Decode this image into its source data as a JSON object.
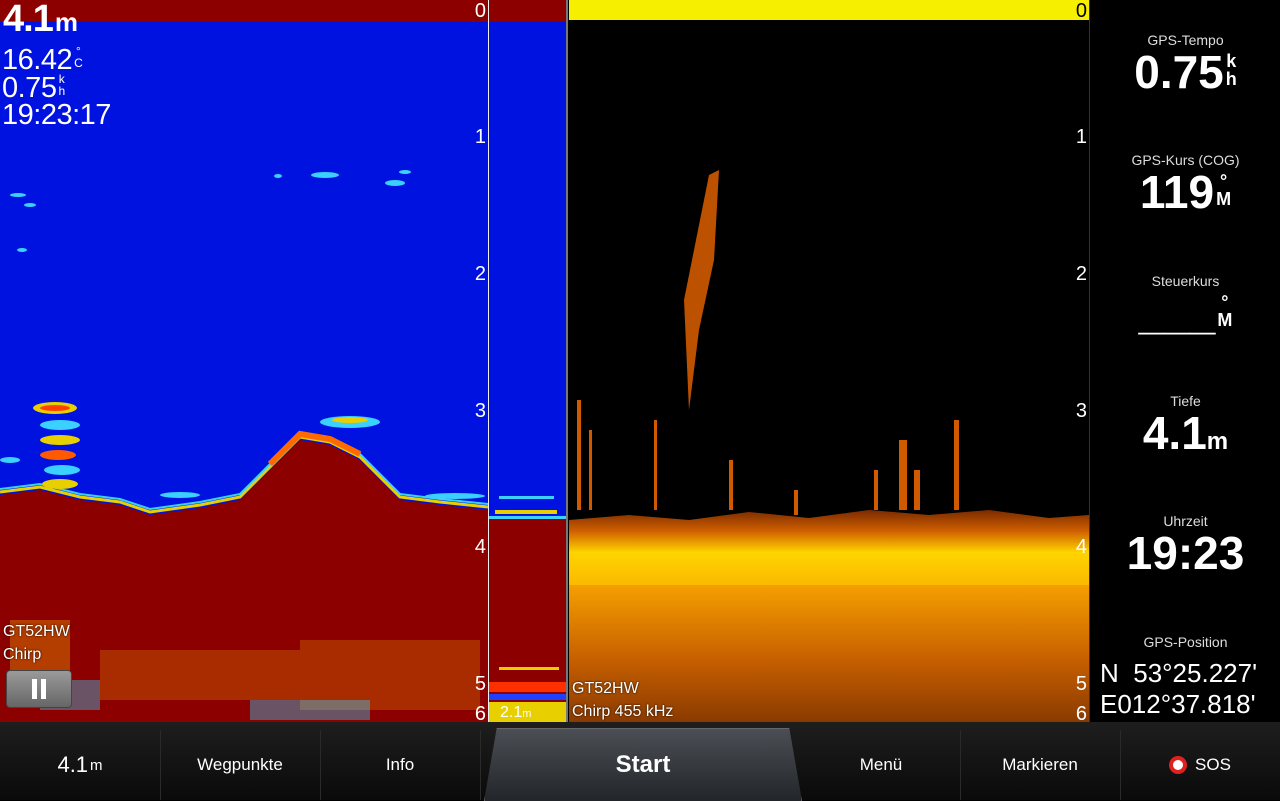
{
  "left_overlay": {
    "depth_value": "4.1",
    "depth_unit": "m",
    "temp_value": "16.42",
    "temp_unit_top": "°",
    "temp_unit_bottom": "C",
    "speed_value": "0.75",
    "speed_unit_top": "k",
    "speed_unit_bottom": "h",
    "time": "19:23:17",
    "transducer": "GT52HW",
    "frequency": "Chirp",
    "flasher_depth": "2.1",
    "flasher_unit": "m"
  },
  "right_overlay": {
    "transducer": "GT52HW",
    "frequency": "Chirp 455 kHz"
  },
  "depth_scale": [
    "0",
    "1",
    "2",
    "3",
    "4",
    "5",
    "6"
  ],
  "sidebar": {
    "gps_speed": {
      "label": "GPS-Tempo",
      "value": "0.75",
      "unit_top": "k",
      "unit_bottom": "h"
    },
    "gps_course": {
      "label": "GPS-Kurs (COG)",
      "value": "119",
      "unit_top": "°",
      "unit_bottom": "M"
    },
    "heading": {
      "label": "Steuerkurs",
      "value": "___",
      "unit_top": "°",
      "unit_bottom": "M"
    },
    "depth": {
      "label": "Tiefe",
      "value": "4.1",
      "unit": "m"
    },
    "time": {
      "label": "Uhrzeit",
      "value": "19:23"
    },
    "position": {
      "label": "GPS-Position",
      "lat_prefix": "N",
      "lat": "53°25.227'",
      "lon_prefix": "E",
      "lon": "012°37.818'"
    }
  },
  "bottom_bar": {
    "depth_value": "4.1",
    "depth_unit": "m",
    "waypoints": "Wegpunkte",
    "info": "Info",
    "start": "Start",
    "menu": "Menü",
    "mark": "Markieren",
    "sos": "SOS"
  },
  "colors": {
    "sonar_water": "#0012e0",
    "sonar_bottom": "#8c0000",
    "chirp_bar": "#f6ef00",
    "sos_red": "#e02020"
  }
}
